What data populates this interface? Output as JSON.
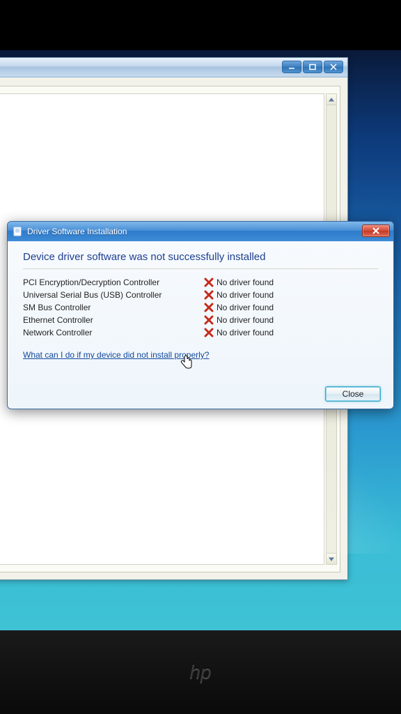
{
  "dialog": {
    "title": "Driver Software Installation",
    "heading": "Device driver software was not successfully installed",
    "help_link": "What can I do if my device did not install properly?",
    "close_label": "Close"
  },
  "devices": [
    {
      "name": "PCI Encryption/Decryption Controller",
      "status": "No driver found"
    },
    {
      "name": "Universal Serial Bus (USB) Controller",
      "status": "No driver found"
    },
    {
      "name": "SM Bus Controller",
      "status": "No driver found"
    },
    {
      "name": "Ethernet Controller",
      "status": "No driver found"
    },
    {
      "name": "Network Controller",
      "status": "No driver found"
    }
  ],
  "background_window": {
    "controls": [
      "minimize",
      "maximize",
      "close"
    ]
  },
  "oem_logo": "hp"
}
